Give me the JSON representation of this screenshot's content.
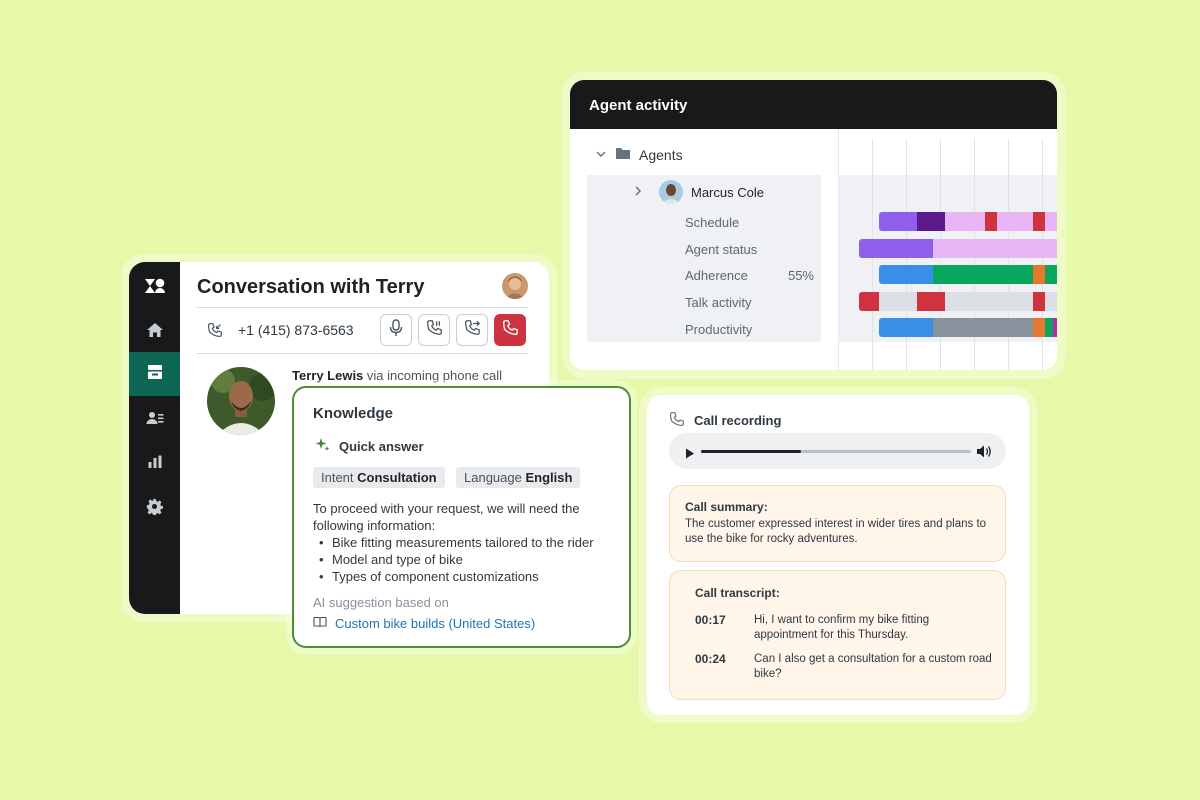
{
  "conversation": {
    "title": "Conversation with Terry",
    "phone_number": "+1 (415) 873-6563",
    "caller_name": "Terry Lewis",
    "caller_via": "via incoming phone call",
    "sidebar_icons": [
      "zendesk-logo-icon",
      "home-icon",
      "inbox-icon",
      "contacts-icon",
      "bar-chart-icon",
      "gear-icon"
    ],
    "call_buttons": [
      "microphone-icon",
      "hold-icon",
      "transfer-icon",
      "end-call-icon"
    ],
    "end_call_color": "#cc3340",
    "active_nav_color": "#0d6553"
  },
  "knowledge": {
    "title": "Knowledge",
    "quick_answer": "Quick answer",
    "tags": [
      {
        "key": "Intent",
        "value": "Consultation"
      },
      {
        "key": "Language",
        "value": "English"
      }
    ],
    "intro": "To proceed with your request, we will need the following information:",
    "items": [
      "Bike fitting measurements tailored to the rider",
      "Model and type of bike",
      "Types of component customizations"
    ],
    "ai_note": "AI suggestion based on",
    "source_link": "Custom bike builds (United States)",
    "border_color": "#4c8f35"
  },
  "agent_activity": {
    "title": "Agent activity",
    "group": "Agents",
    "agent_name": "Marcus Cole",
    "metrics": [
      "Schedule",
      "Agent status",
      "Adherence",
      "Talk activity",
      "Productivity"
    ],
    "adherence_value": "55%",
    "timeline_colors": {
      "purple": "#8d5fea",
      "dark_purple": "#5c1a8e",
      "lavender": "#e9b5f5",
      "red": "#cf3340",
      "blue": "#3a8ee6",
      "green": "#0aa660",
      "orange": "#e6782e",
      "gray": "#87929d",
      "light": "#dcdfe6",
      "magenta": "#b52ca6"
    }
  },
  "call_recording": {
    "title": "Call recording",
    "progress": 0.37,
    "summary_heading": "Call summary:",
    "summary_text": "The customer expressed interest in wider tires and plans to use the bike for rocky adventures.",
    "transcript_heading": "Call transcript:",
    "transcript": [
      {
        "time": "00:17",
        "text": "Hi, I want to confirm my bike fitting appointment for this Thursday."
      },
      {
        "time": "00:24",
        "text": "Can I also get a consultation for a custom road bike?"
      }
    ]
  }
}
